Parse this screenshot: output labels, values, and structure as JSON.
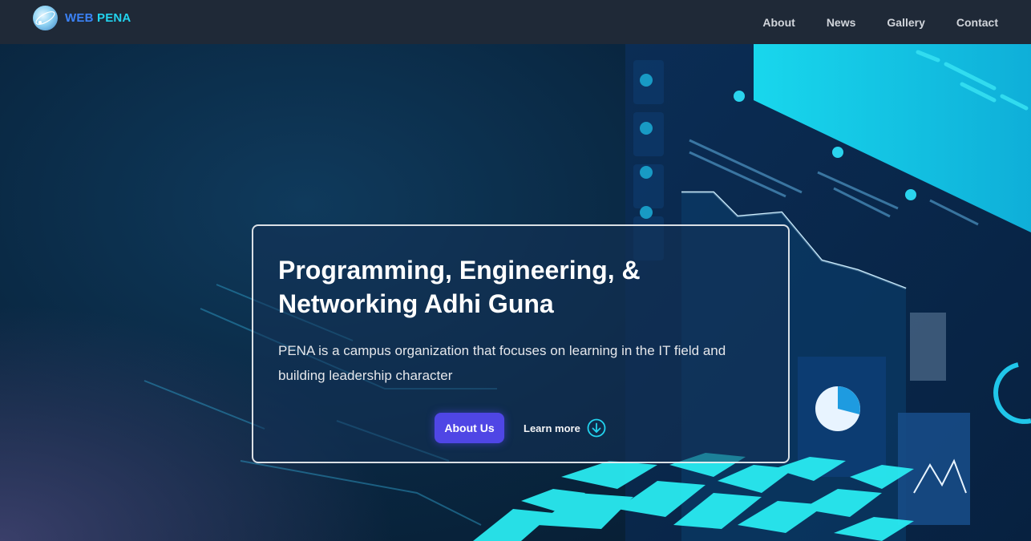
{
  "navbar": {
    "brand_web": "WEB",
    "brand_pena": "PENA",
    "links": [
      "About",
      "News",
      "Gallery",
      "Contact"
    ]
  },
  "hero": {
    "title": "Programming, Engineering, & Networking Adhi Guna",
    "description": "PENA is a campus organization that focuses on learning in the IT field and building leadership character",
    "primary_button": "About Us",
    "secondary_link": "Learn more",
    "secondary_icon": "arrow-down-circle-icon"
  },
  "colors": {
    "navbar_bg": "#1f2937",
    "brand_web": "#3b82f6",
    "brand_pena": "#22d3ee",
    "primary_button": "#4f46e5",
    "accent_cyan": "#22d3ee"
  }
}
